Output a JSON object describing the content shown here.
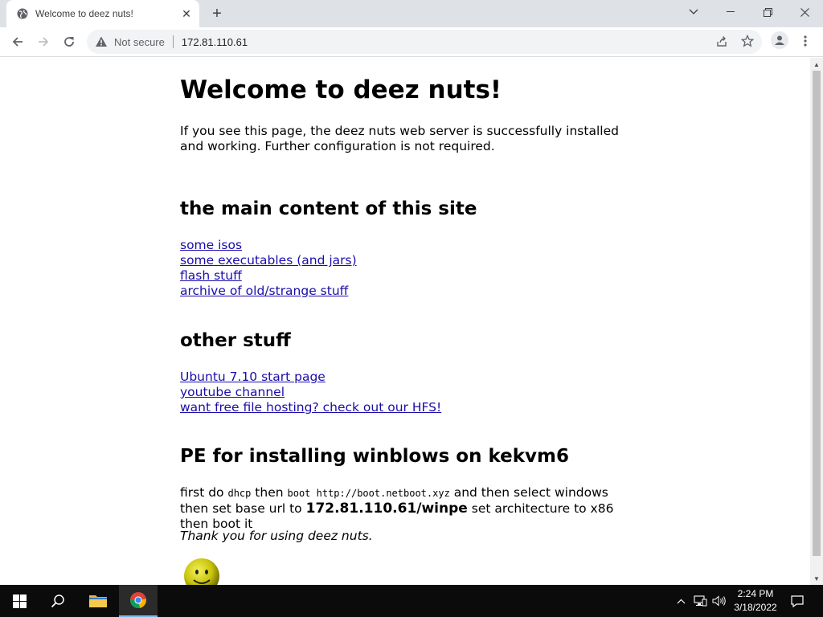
{
  "browser": {
    "tab_title": "Welcome to deez nuts!",
    "security_label": "Not secure",
    "url": "172.81.110.61"
  },
  "page": {
    "heading": "Welcome to deez nuts!",
    "intro": "If you see this page, the deez nuts web server is successfully installed and working. Further configuration is not required.",
    "section_main": {
      "title": "the main content of this site",
      "links": [
        "some isos",
        "some executables (and jars)",
        "flash stuff",
        "archive of old/strange stuff"
      ]
    },
    "section_other": {
      "title": "other stuff",
      "links": [
        "Ubuntu 7.10 start page",
        "youtube channel",
        "want free file hosting? check out our HFS!"
      ]
    },
    "section_pe": {
      "title": "PE for installing winblows on kekvm6",
      "t1": "first do ",
      "c1": "dhcp",
      "t2": " then ",
      "c2": "boot http://boot.netboot.xyz",
      "t3": " and then select windows then set base url to ",
      "b1": "172.81.110.61/winpe",
      "t4": " set architecture to x86 then boot it"
    },
    "thanks": "Thank you for using deez nuts."
  },
  "taskbar": {
    "time": "2:24 PM",
    "date": "3/18/2022"
  },
  "colors": {
    "link": "#1a0dab",
    "tabstrip": "#dee1e6",
    "taskbar": "#0b0b0b"
  }
}
